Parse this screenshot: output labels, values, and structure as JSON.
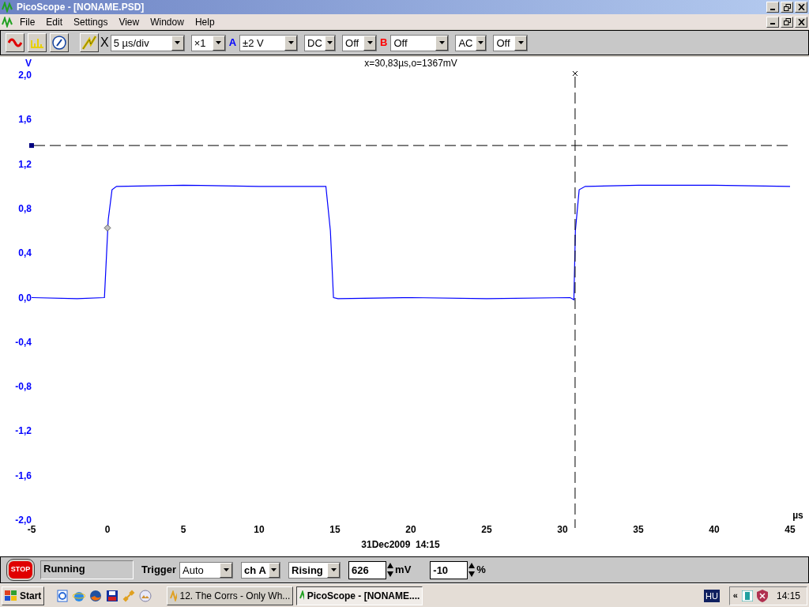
{
  "window": {
    "title": "PicoScope - [NONAME.PSD]"
  },
  "menu": [
    "File",
    "Edit",
    "Settings",
    "View",
    "Window",
    "Help"
  ],
  "toolbar": {
    "timebase_label": "X",
    "timebase": "5 µs/div",
    "multiplier": "×1",
    "channels": [
      {
        "label": "A",
        "color": "#0000ff",
        "range": "±2 V",
        "coupling": "DC",
        "option": "Off"
      },
      {
        "label": "B",
        "color": "#ff0000",
        "range": "Off",
        "coupling": "AC",
        "option": "Off"
      }
    ]
  },
  "plot": {
    "chart_data": {
      "type": "line",
      "title": "x=30,83µs,o=1367mV",
      "xlabel": "µs",
      "ylabel": "V",
      "xlim": [
        -5,
        45
      ],
      "ylim": [
        -2,
        2
      ],
      "xticks": [
        -5,
        0,
        5,
        10,
        15,
        20,
        25,
        30,
        35,
        40,
        45
      ],
      "yticks": [
        {
          "value": 2,
          "label": "2,0"
        },
        {
          "value": 1.6,
          "label": "1,6"
        },
        {
          "value": 1.2,
          "label": "1,2"
        },
        {
          "value": 0.8,
          "label": "0,8"
        },
        {
          "value": 0.4,
          "label": "0,4"
        },
        {
          "value": 0,
          "label": "0,0"
        },
        {
          "value": -0.4,
          "label": "-0,4"
        },
        {
          "value": -0.8,
          "label": "-0,8"
        },
        {
          "value": -1.2,
          "label": "-1,2"
        },
        {
          "value": -1.6,
          "label": "-1,6"
        },
        {
          "value": -2,
          "label": "-2,0"
        }
      ],
      "x": [
        -5,
        -2,
        -0.2,
        0.05,
        0.3,
        0.6,
        5,
        10,
        14.4,
        14.7,
        14.9,
        15.2,
        20,
        25,
        30.5,
        30.75,
        30.85,
        31.1,
        31.5,
        35,
        40,
        45
      ],
      "series": [
        {
          "color": "#0000ff",
          "values": [
            0,
            -0.01,
            0,
            0.7,
            0.97,
            1,
            1.01,
            1,
            1,
            0.6,
            0,
            -0.01,
            0,
            -0.01,
            0,
            -0.02,
            0.6,
            0.97,
            1,
            1.01,
            1.01,
            1
          ]
        }
      ],
      "ref_lines": [
        {
          "axis": "x",
          "value": 30.83
        },
        {
          "axis": "y",
          "value": 1.367
        }
      ]
    },
    "timestamp": "31Dec2009  14:15"
  },
  "status": {
    "stop_label": "STOP",
    "state": "Running",
    "trigger_label": "Trigger",
    "mode": "Auto",
    "channel": "ch A",
    "edge": "Rising",
    "level": "626",
    "level_unit": "mV",
    "delay": "-10",
    "delay_unit": "%"
  },
  "taskbar": {
    "start": "Start",
    "quick_launch": [
      {
        "kind": "ie-page"
      },
      {
        "kind": "ie"
      },
      {
        "kind": "firefox"
      },
      {
        "kind": "disk"
      },
      {
        "kind": "link"
      },
      {
        "kind": "globe"
      }
    ],
    "tasks": [
      {
        "label": "12. The Corrs - Only Wh...",
        "selected": false
      },
      {
        "label": "PicoScope - [NONAME....",
        "selected": true
      }
    ],
    "language": "HU",
    "tray_toggle": "«",
    "clock": "14:15"
  }
}
